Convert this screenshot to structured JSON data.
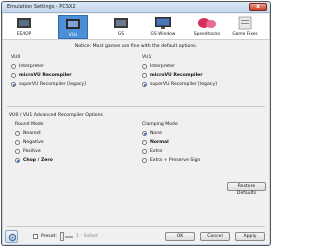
{
  "window": {
    "title": "Emulation Settings - PCSX2",
    "close_glyph": "x"
  },
  "tabs": [
    {
      "label": "EE/IOP",
      "icon": "chip-icon",
      "active": false
    },
    {
      "label": "VUs",
      "icon": "vu-chip-icon",
      "active": true
    },
    {
      "label": "GS",
      "icon": "gs-chip-icon",
      "active": false
    },
    {
      "label": "GS Window",
      "icon": "monitor-icon",
      "active": false
    },
    {
      "label": "Speedhacks",
      "icon": "speedhacks-icon",
      "active": false
    },
    {
      "label": "Game Fixes",
      "icon": "game-fixes-icon",
      "active": false
    }
  ],
  "notice": "Notice: Most games are fine with the default options.",
  "vu0": {
    "label": "VU0",
    "options": [
      "Interpreter",
      "microVU Recompiler",
      "superVU Recompiler [legacy]"
    ],
    "selected": 2
  },
  "vu1": {
    "label": "VU1",
    "options": [
      "Interpreter",
      "microVU Recompiler",
      "superVU Recompiler [legacy]"
    ],
    "selected": 2
  },
  "advanced": {
    "label": "VU0 / VU1 Advanced Recompiler Options",
    "round_mode": {
      "label": "Round Mode",
      "options": [
        "Nearest",
        "Negative",
        "Positive",
        "Chop / Zero"
      ],
      "selected": 3
    },
    "clamping_mode": {
      "label": "Clamping Mode",
      "options": [
        "None",
        "Normal",
        "Extra",
        "Extra + Preserve Sign"
      ],
      "selected": 0
    }
  },
  "buttons": {
    "restore": "Restore Defaults",
    "ok": "OK",
    "cancel": "Cancel",
    "apply": "Apply"
  },
  "presets": {
    "label": "Preset:",
    "checked": false,
    "value_label": "1 - Safest"
  },
  "colors": {
    "accent": "#4d8fd6",
    "title_bar": "#c4d6ec",
    "close": "#c4432c"
  }
}
